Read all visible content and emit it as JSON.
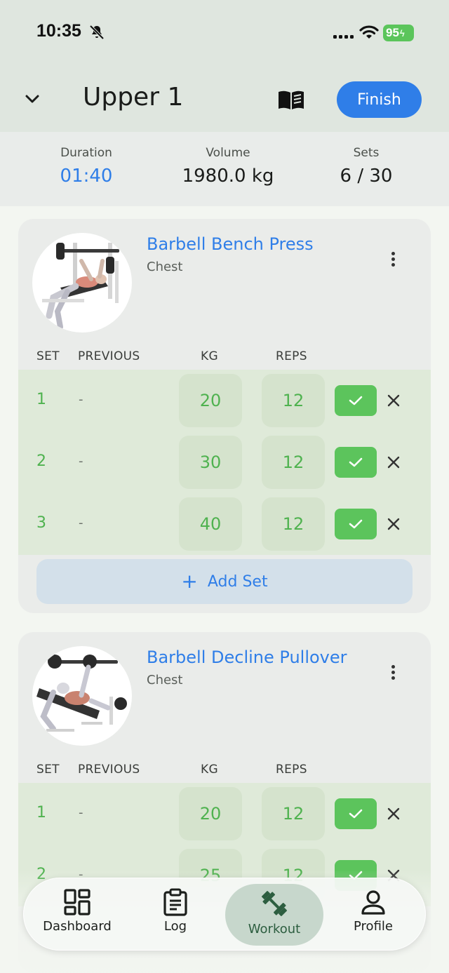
{
  "status_bar": {
    "time": "10:35",
    "battery": "95",
    "icons": [
      "bell-slash-icon",
      "signal-icon",
      "wifi-icon",
      "battery-charging-icon"
    ]
  },
  "header": {
    "title": "Upper 1",
    "finish_label": "Finish",
    "icons": [
      "chevron-down-icon",
      "book-icon"
    ]
  },
  "stats": {
    "duration_label": "Duration",
    "duration_value": "01:40",
    "volume_label": "Volume",
    "volume_value": "1980.0 kg",
    "sets_label": "Sets",
    "sets_value": "6 / 30"
  },
  "columns": {
    "set": "SET",
    "previous": "PREVIOUS",
    "kg": "KG",
    "reps": "REPS"
  },
  "exercises": [
    {
      "name": "Barbell Bench Press",
      "muscle": "Chest",
      "sets": [
        {
          "num": "1",
          "previous": "-",
          "kg": "20",
          "reps": "12",
          "completed": true
        },
        {
          "num": "2",
          "previous": "-",
          "kg": "30",
          "reps": "12",
          "completed": true
        },
        {
          "num": "3",
          "previous": "-",
          "kg": "40",
          "reps": "12",
          "completed": true
        }
      ],
      "add_set_label": "Add Set"
    },
    {
      "name": "Barbell Decline Pullover",
      "muscle": "Chest",
      "sets": [
        {
          "num": "1",
          "previous": "-",
          "kg": "20",
          "reps": "12",
          "completed": true
        },
        {
          "num": "2",
          "previous": "-",
          "kg": "25",
          "reps": "12",
          "completed": true
        }
      ]
    }
  ],
  "nav": {
    "items": [
      {
        "label": "Dashboard",
        "icon": "dashboard-grid-icon",
        "active": false
      },
      {
        "label": "Log",
        "icon": "clipboard-icon",
        "active": false
      },
      {
        "label": "Workout",
        "icon": "dumbbell-icon",
        "active": true
      },
      {
        "label": "Profile",
        "icon": "person-icon",
        "active": false
      }
    ]
  },
  "colors": {
    "accent_blue": "#2f7ee8",
    "complete_green": "#5cc45c",
    "completed_row": "#dfead9",
    "nav_active": "#a8c2b0"
  }
}
